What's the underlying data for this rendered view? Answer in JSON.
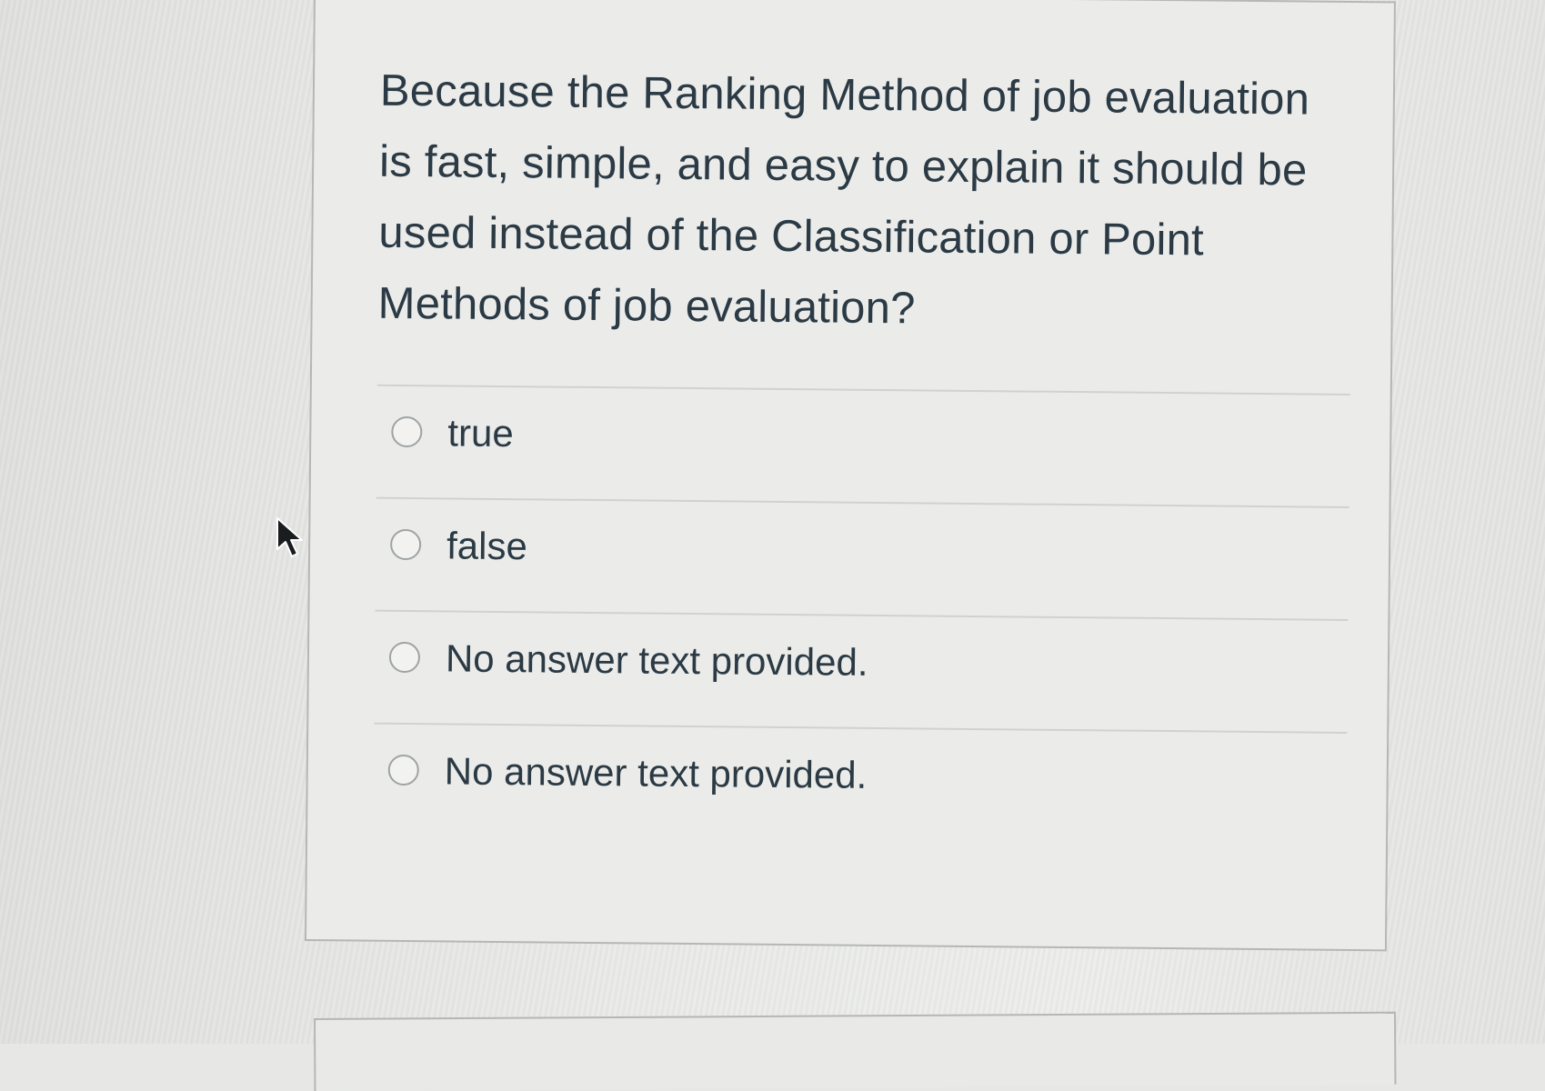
{
  "quiz": {
    "question_text": "Because the Ranking Method of job evaluation is fast, simple, and easy to explain it should be used instead of the Classification or Point Methods of job evaluation?",
    "answers": [
      {
        "label": "true",
        "selected": false
      },
      {
        "label": "false",
        "selected": false
      },
      {
        "label": "No answer text provided.",
        "selected": false
      },
      {
        "label": "No answer text provided.",
        "selected": false
      }
    ]
  },
  "cursor": {
    "icon": "arrow-pointer-icon"
  },
  "colors": {
    "text": "#2b3a44",
    "card_border": "#b4b7b6",
    "divider": "#cfd2d1",
    "radio_border": "#9ea3a4"
  }
}
